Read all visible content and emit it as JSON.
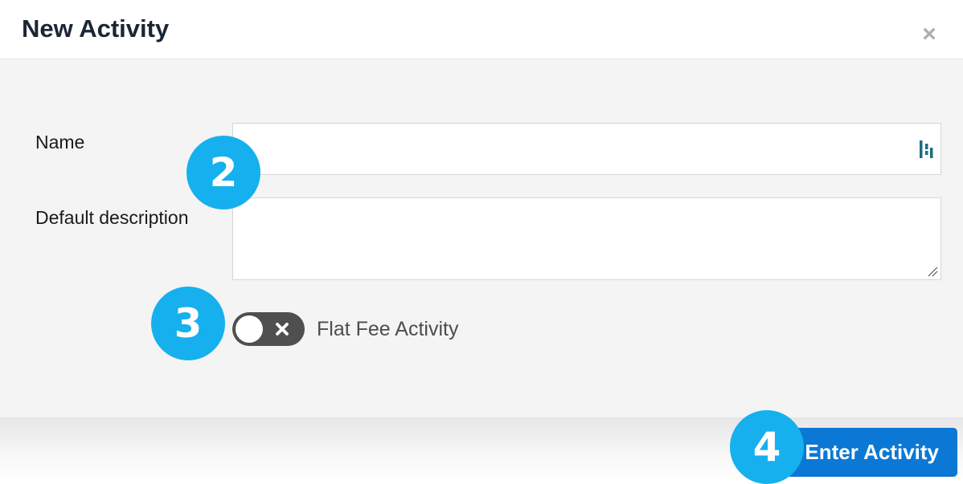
{
  "dialog": {
    "title": "New Activity",
    "close_label": "×"
  },
  "form": {
    "name_label": "Name",
    "name_value": "",
    "description_label": "Default description",
    "description_value": "",
    "toggle_label": "Flat Fee Activity",
    "toggle_state": "off",
    "toggle_off_glyph": "✖"
  },
  "footer": {
    "submit_label": "Enter Activity"
  },
  "step_markers": [
    "2",
    "3",
    "4"
  ],
  "colors": {
    "primary_button": "#0b78d6",
    "step_marker": "#16b0ee",
    "toggle_track": "#4f4f4f",
    "title": "#1b2536"
  }
}
